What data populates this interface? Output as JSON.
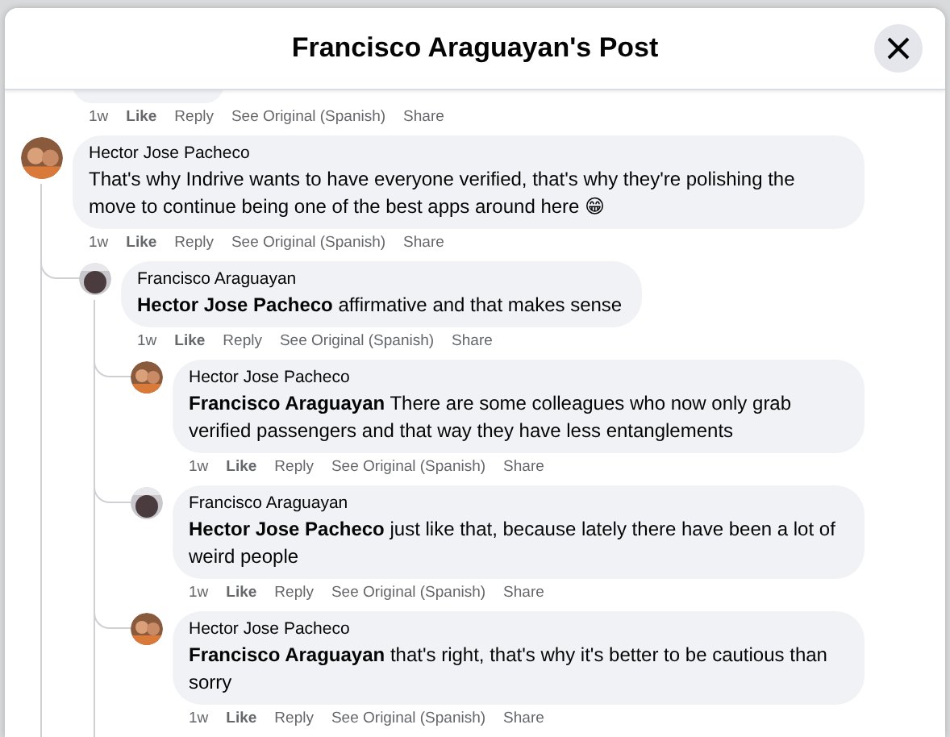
{
  "window": {
    "title": "Francisco Araguayan's Post"
  },
  "comments": [
    {
      "kind": "cut",
      "time": "1w",
      "actions": [
        {
          "kind": "like",
          "label": "Like"
        },
        {
          "kind": "reply",
          "label": "Reply"
        },
        {
          "kind": "translate",
          "label": "See Original (Spanish)"
        },
        {
          "kind": "share",
          "label": "Share"
        }
      ]
    },
    {
      "kind": "full",
      "author": "Hector Jose Pacheco",
      "text": "That's why Indrive wants to have everyone verified, that's why they're polishing the move to continue being one of the best apps around here 😁",
      "time": "1w",
      "actions": [
        {
          "kind": "like",
          "label": "Like"
        },
        {
          "kind": "reply",
          "label": "Reply"
        },
        {
          "kind": "translate",
          "label": "See Original (Spanish)"
        },
        {
          "kind": "share",
          "label": "Share"
        }
      ],
      "children": [
        {
          "kind": "full",
          "author": "Francisco Araguayan",
          "mention": "Hector Jose Pacheco",
          "text": "affirmative and that makes sense",
          "time": "1w",
          "actions": [
            {
              "kind": "like",
              "label": "Like"
            },
            {
              "kind": "reply",
              "label": "Reply"
            },
            {
              "kind": "translate",
              "label": "See Original (Spanish)"
            },
            {
              "kind": "share",
              "label": "Share"
            }
          ],
          "children": [
            {
              "kind": "full",
              "author": "Hector Jose Pacheco",
              "mention": "Francisco Araguayan",
              "text": "There are some colleagues who now only grab verified passengers and that way they have less entanglements",
              "time": "1w",
              "actions": [
                {
                  "kind": "like",
                  "label": "Like"
                },
                {
                  "kind": "reply",
                  "label": "Reply"
                },
                {
                  "kind": "translate",
                  "label": "See Original (Spanish)"
                },
                {
                  "kind": "share",
                  "label": "Share"
                }
              ]
            },
            {
              "kind": "full",
              "author": "Francisco Araguayan",
              "mention": "Hector Jose Pacheco",
              "text": "just like that, because lately there have been a lot of weird people",
              "time": "1w",
              "actions": [
                {
                  "kind": "like",
                  "label": "Like"
                },
                {
                  "kind": "reply",
                  "label": "Reply"
                },
                {
                  "kind": "translate",
                  "label": "See Original (Spanish)"
                },
                {
                  "kind": "share",
                  "label": "Share"
                }
              ]
            },
            {
              "kind": "full",
              "author": "Hector Jose Pacheco",
              "mention": "Francisco Araguayan",
              "text": "that's right, that's why it's better to be cautious than sorry",
              "time": "1w",
              "actions": [
                {
                  "kind": "like",
                  "label": "Like"
                },
                {
                  "kind": "reply",
                  "label": "Reply"
                },
                {
                  "kind": "translate",
                  "label": "See Original (Spanish)"
                },
                {
                  "kind": "share",
                  "label": "Share"
                }
              ]
            }
          ]
        }
      ]
    }
  ]
}
